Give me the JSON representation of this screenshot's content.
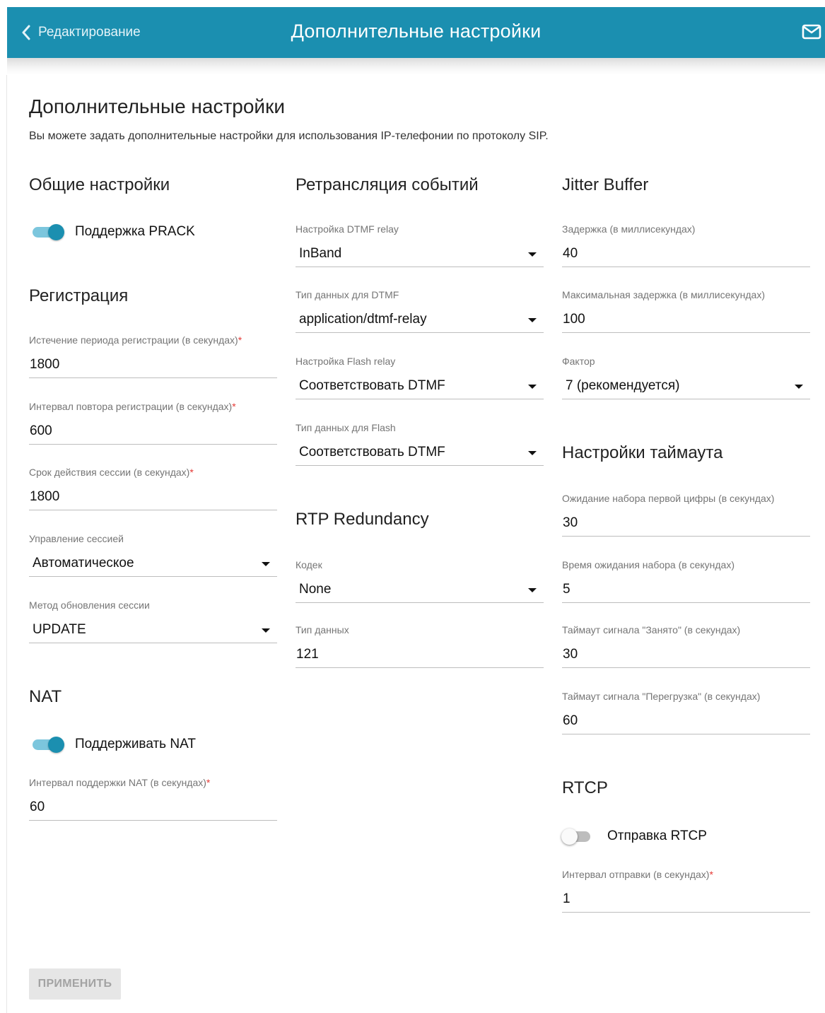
{
  "header": {
    "back_label": "Редактирование",
    "title": "Дополнительные настройки",
    "accent_color": "#1b8fb0"
  },
  "page": {
    "title": "Дополнительные настройки",
    "description": "Вы можете задать дополнительные настройки для использования IP-телефонии по протоколу SIP."
  },
  "general": {
    "title": "Общие настройки",
    "prack_label": "Поддержка PRACK",
    "prack_on": true
  },
  "registration": {
    "title": "Регистрация",
    "expire_label": "Истечение периода регистрации (в секундах)",
    "expire_value": "1800",
    "retry_label": "Интервал повтора регистрации (в секундах)",
    "retry_value": "600",
    "session_label": "Срок действия сессии (в секундах)",
    "session_value": "1800",
    "session_control_label": "Управление сессией",
    "session_control_value": "Автоматическое",
    "refresh_method_label": "Метод обновления сессии",
    "refresh_method_value": "UPDATE"
  },
  "nat": {
    "title": "NAT",
    "support_label": "Поддерживать NAT",
    "support_on": true,
    "interval_label": "Интервал поддержки NAT (в секундах)",
    "interval_value": "60"
  },
  "relay": {
    "title": "Ретрансляция событий",
    "dtmf_relay_label": "Настройка DTMF relay",
    "dtmf_relay_value": "InBand",
    "dtmf_type_label": "Тип данных для DTMF",
    "dtmf_type_value": "application/dtmf-relay",
    "flash_relay_label": "Настройка Flash relay",
    "flash_relay_value": "Соответствовать DTMF",
    "flash_type_label": "Тип данных для Flash",
    "flash_type_value": "Соответствовать DTMF"
  },
  "rtp": {
    "title": "RTP Redundancy",
    "codec_label": "Кодек",
    "codec_value": "None",
    "data_type_label": "Тип данных",
    "data_type_value": "121"
  },
  "jitter": {
    "title": "Jitter Buffer",
    "delay_label": "Задержка (в миллисекундах)",
    "delay_value": "40",
    "max_delay_label": "Максимальная задержка (в миллисекундах)",
    "max_delay_value": "100",
    "factor_label": "Фактор",
    "factor_value": "7 (рекомендуется)"
  },
  "timeout": {
    "title": "Настройки таймаута",
    "first_digit_label": "Ожидание набора первой цифры (в секундах)",
    "first_digit_value": "30",
    "dial_wait_label": "Время ожидания набора (в секундах)",
    "dial_wait_value": "5",
    "busy_label": "Таймаут сигнала \"Занято\" (в секундах)",
    "busy_value": "30",
    "overload_label": "Таймаут сигнала \"Перегрузка\" (в секундах)",
    "overload_value": "60"
  },
  "rtcp": {
    "title": "RTCP",
    "send_label": "Отправка RTCP",
    "send_on": false,
    "interval_label": "Интервал отправки (в секундах)",
    "interval_value": "1"
  },
  "apply_label": "ПРИМЕНИТЬ",
  "required_mark": "*"
}
